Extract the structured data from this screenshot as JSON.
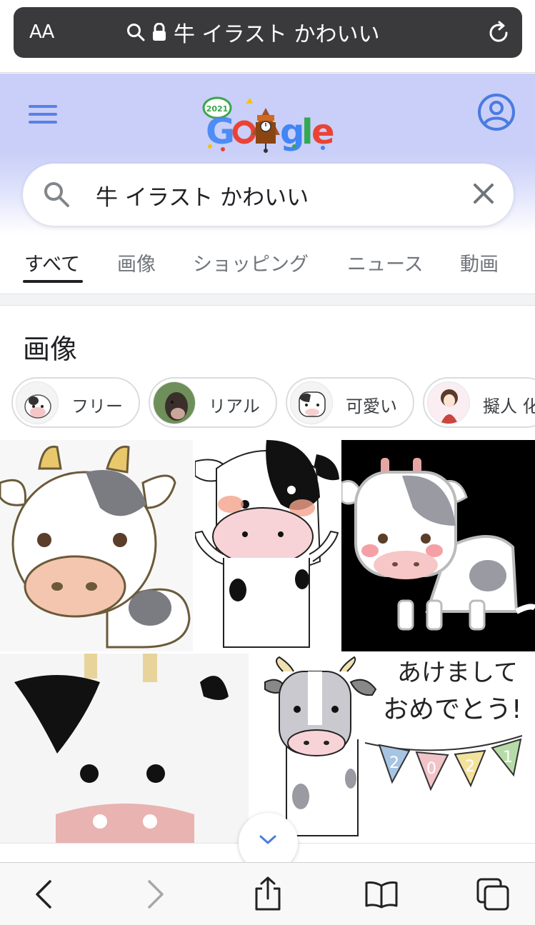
{
  "browser": {
    "text_size_label": "AA",
    "url_text": "牛 イラスト かわいい"
  },
  "search": {
    "query": "牛 イラスト かわいい"
  },
  "tabs": [
    {
      "label": "すべて",
      "active": true
    },
    {
      "label": "画像",
      "active": false
    },
    {
      "label": "ショッピング",
      "active": false
    },
    {
      "label": "ニュース",
      "active": false
    },
    {
      "label": "動画",
      "active": false
    }
  ],
  "images_section": {
    "title": "画像",
    "chips": [
      {
        "label": "フリー"
      },
      {
        "label": "リアル"
      },
      {
        "label": "可愛い"
      },
      {
        "label": "擬人 化"
      }
    ],
    "results": [
      {
        "kind": "cow-illustration"
      },
      {
        "kind": "cow-illustration"
      },
      {
        "kind": "cow-illustration-dark"
      },
      {
        "kind": "cow-closeup"
      },
      {
        "kind": "new-year-card",
        "card_text_line1": "あけまして",
        "card_text_line2": "おめでとう!",
        "banner_digits": [
          "2",
          "0",
          "2",
          "1"
        ]
      }
    ]
  },
  "doodle": {
    "badge_text": "2021"
  },
  "colors": {
    "accent_blue": "#4a7be0",
    "header_bg": "#c9cff8",
    "cow_spot": "#8e8e96"
  }
}
